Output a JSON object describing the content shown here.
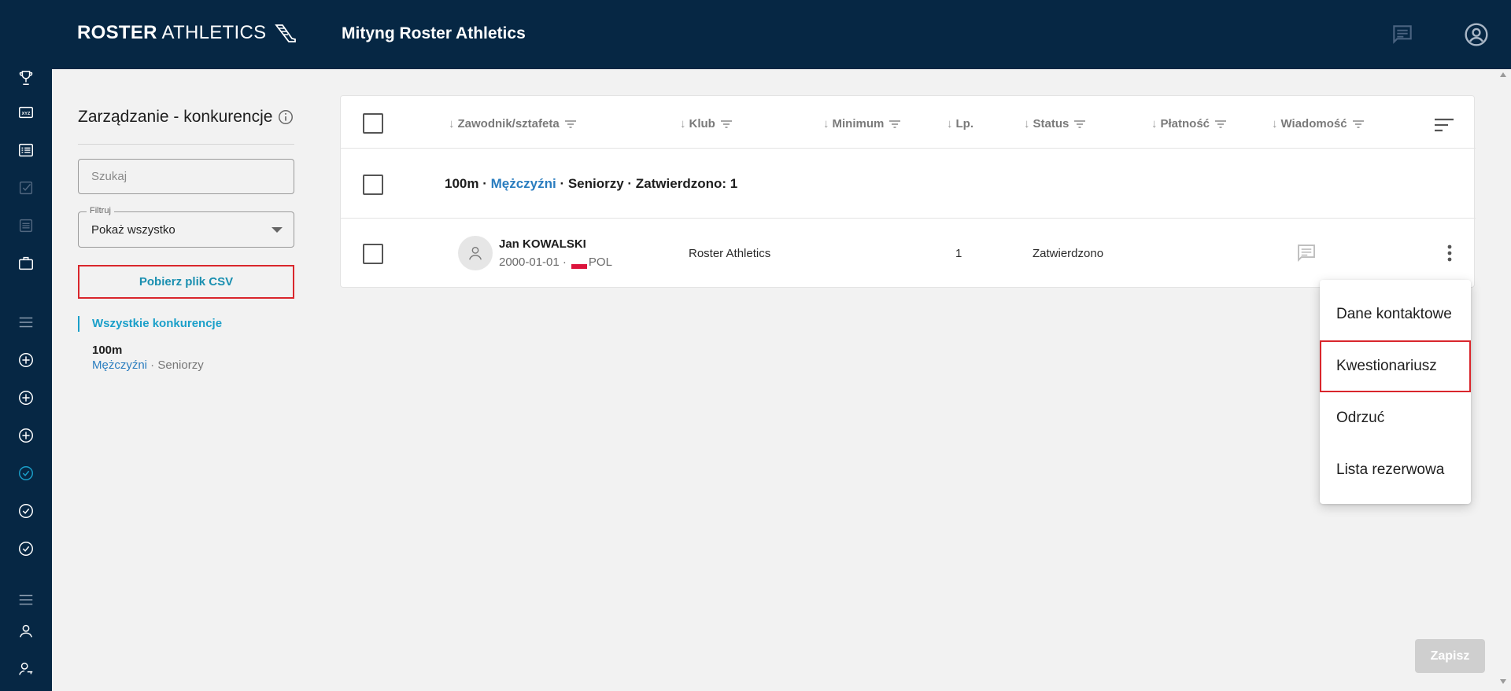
{
  "header": {
    "logo_bold": "ROSTER",
    "logo_light": "ATHLETICS",
    "title": "Mityng Roster Athletics",
    "icons": [
      "message-icon",
      "account-icon"
    ]
  },
  "sidebar": {
    "icons": [
      "trophy-icon",
      "xyz-icon",
      "list-icon",
      "checkbox-icon",
      "document-icon",
      "briefcase-icon",
      "menu-icon",
      "add-circle-icon",
      "add-circle-icon",
      "add-circle-icon",
      "check-circle-icon",
      "check-circle-icon",
      "check-circle-icon",
      "menu-icon",
      "person-icon",
      "person-key-icon"
    ]
  },
  "panel": {
    "title": "Zarządzanie - konkurencje",
    "search_placeholder": "Szukaj",
    "filter_label": "Filtruj",
    "filter_value": "Pokaż wszystko",
    "csv_button": "Pobierz plik CSV",
    "nav_all": "Wszystkie konkurencje",
    "event_name": "100m",
    "event_sex": "Mężczyźni",
    "event_sep": " · ",
    "event_age": "Seniorzy"
  },
  "table": {
    "columns": [
      "Zawodnik/sztafeta",
      "Klub",
      "Minimum",
      "Lp.",
      "Status",
      "Płatność",
      "Wiadomość"
    ],
    "sort_arrow": "↓",
    "group": {
      "event": "100m · ",
      "sex": "Mężczyźni",
      "rest": " · Seniorzy · Zatwierdzono: 1"
    },
    "row": {
      "name": "Jan KOWALSKI",
      "birth": "2000-01-01 ·",
      "country": "POL",
      "club": "Roster Athletics",
      "lp": "1",
      "status": "Zatwierdzono"
    }
  },
  "menu": {
    "items": [
      "Dane kontaktowe",
      "Kwestionariusz",
      "Odrzuć",
      "Lista rezerwowa"
    ]
  },
  "save_button": "Zapisz",
  "colors": {
    "navy": "#062744",
    "accent": "#1a9fc9",
    "link": "#2a7dbf",
    "highlight": "#d9262c"
  }
}
